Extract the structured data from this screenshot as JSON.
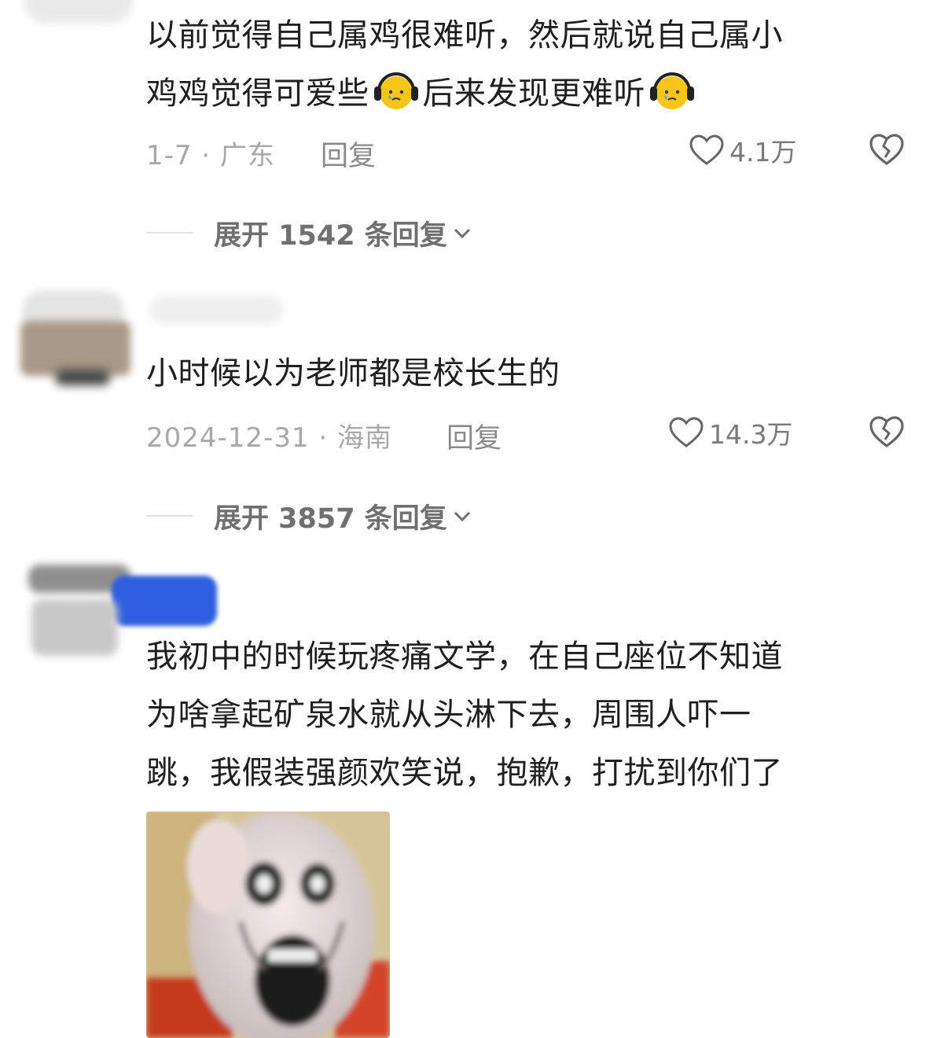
{
  "comments": [
    {
      "text_line1": "以前觉得自己属鸡很难听，然后就说自己属小",
      "text_line2_a": "鸡鸡觉得可爱些",
      "text_line2_b": "后来发现更难听",
      "date_location": "1-7 · 广东",
      "reply_label": "回复",
      "likes": "4.1万",
      "expand_label": "展开 1542 条回复"
    },
    {
      "text": "小时候以为老师都是校长生的",
      "date_location": "2024-12-31 · 海南",
      "reply_label": "回复",
      "likes": "14.3万",
      "expand_label": "展开 3857 条回复"
    },
    {
      "text_line1": "我初中的时候玩疼痛文学，在自己座位不知道",
      "text_line2": "为啥拿起矿泉水就从头淋下去，周围人吓一",
      "text_line3": "跳，我假装强颜欢笑说，抱歉，打扰到你们了"
    }
  ],
  "icons": {
    "emoji": "sad-face-headphones-icon",
    "like": "heart-outline-icon",
    "dislike": "broken-heart-icon",
    "expand": "chevron-down-icon"
  },
  "colors": {
    "text": "#1f1f1f",
    "meta": "#a8a8a8",
    "expand": "#707070",
    "emoji_yellow": "#f5c518",
    "redaction_blue": "#2f5fe0"
  }
}
